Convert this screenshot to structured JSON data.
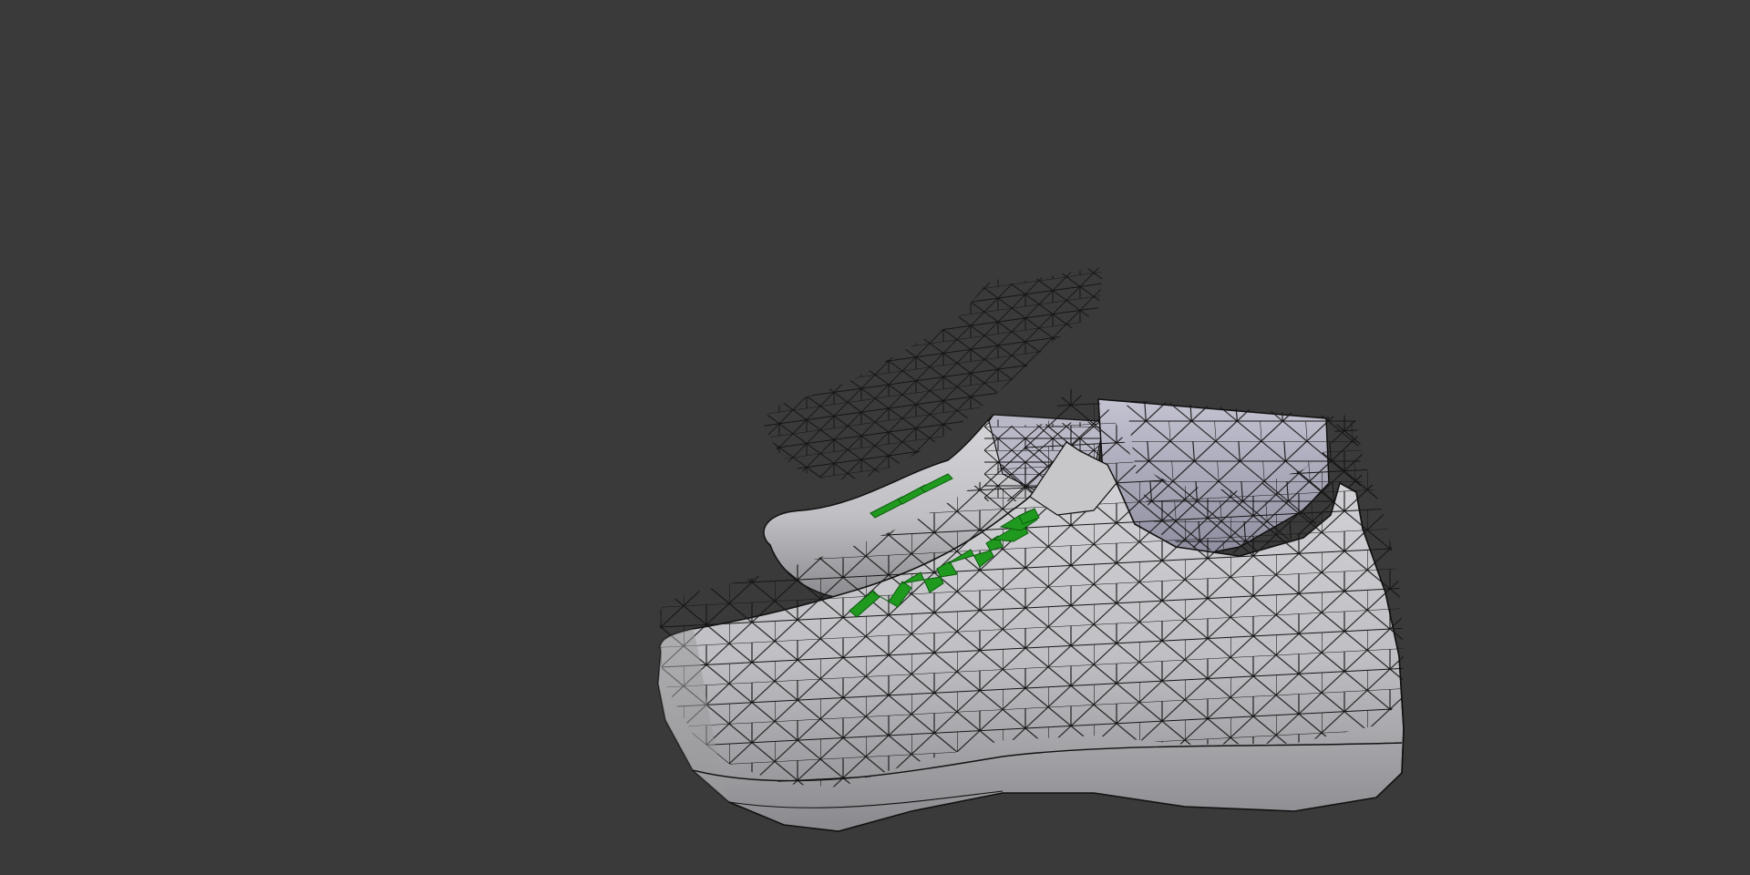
{
  "viewport": {
    "background_color": "#3a3a3a",
    "shading": "solid-with-wireframe",
    "wire_color": "#111111",
    "model_color": "#c9c9cc",
    "lace_color": "#1f9a1f"
  },
  "objects": [
    {
      "name": "rear-shoe",
      "kind": "sneaker-mesh"
    },
    {
      "name": "front-shoe",
      "kind": "sneaker-mesh"
    }
  ]
}
